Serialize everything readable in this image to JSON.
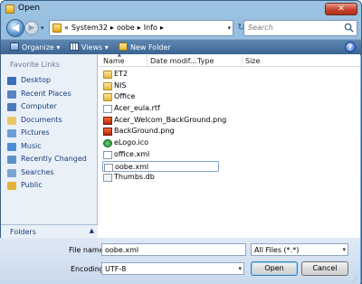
{
  "window": {
    "title": "Open",
    "close_glyph": "✕"
  },
  "nav": {
    "back_glyph": "◀",
    "forward_glyph": "▶",
    "address_path": [
      "«",
      "System32",
      "▸",
      "oobe",
      "▸",
      "Info",
      "▸"
    ],
    "search_placeholder": "Search"
  },
  "toolbar": {
    "organize": "Organize ▾",
    "views": "Views ▾",
    "new_folder": "New Folder",
    "help": "?"
  },
  "sidebar": {
    "heading": "Favorite Links",
    "items": [
      {
        "label": "Desktop",
        "icon": "desktop-icon",
        "color": "#3b6fb5"
      },
      {
        "label": "Recent Places",
        "icon": "recent-places-icon",
        "color": "#5a84c2"
      },
      {
        "label": "Computer",
        "icon": "computer-icon",
        "color": "#4a7bb8"
      },
      {
        "label": "Documents",
        "icon": "documents-icon",
        "color": "#e7c766"
      },
      {
        "label": "Pictures",
        "icon": "pictures-icon",
        "color": "#6aa0d6"
      },
      {
        "label": "Music",
        "icon": "music-icon",
        "color": "#4a8ed6"
      },
      {
        "label": "Recently Changed",
        "icon": "recently-changed-icon",
        "color": "#5e90c9"
      },
      {
        "label": "Searches",
        "icon": "searches-icon",
        "color": "#7aa5d0"
      },
      {
        "label": "Public",
        "icon": "public-icon",
        "color": "#e3b43a"
      }
    ],
    "folders_label": "Folders",
    "folders_chevron": "▲"
  },
  "columns": {
    "name": "Name",
    "date": "Date modif...",
    "type": "Type",
    "size": "Size"
  },
  "files": [
    {
      "name": "ET2",
      "icon": "folder"
    },
    {
      "name": "NIS",
      "icon": "folder"
    },
    {
      "name": "Office",
      "icon": "folder"
    },
    {
      "name": "Acer_eula.rtf",
      "icon": "doc"
    },
    {
      "name": "Acer_Welcom_BackGround.png",
      "icon": "png"
    },
    {
      "name": "BackGround.png",
      "icon": "png"
    },
    {
      "name": "eLogo.ico",
      "icon": "ico"
    },
    {
      "name": "office.xml",
      "icon": "doc"
    },
    {
      "name": "oobe.xml",
      "icon": "doc",
      "selected": true
    },
    {
      "name": "Thumbs.db",
      "icon": "db"
    }
  ],
  "form": {
    "filename_label": "File name:",
    "filename_value": "oobe.xml",
    "filetype_value": "All Files (*.*)",
    "encoding_label": "Encoding:",
    "encoding_value": "UTF-8",
    "open_label": "Open",
    "cancel_label": "Cancel"
  }
}
